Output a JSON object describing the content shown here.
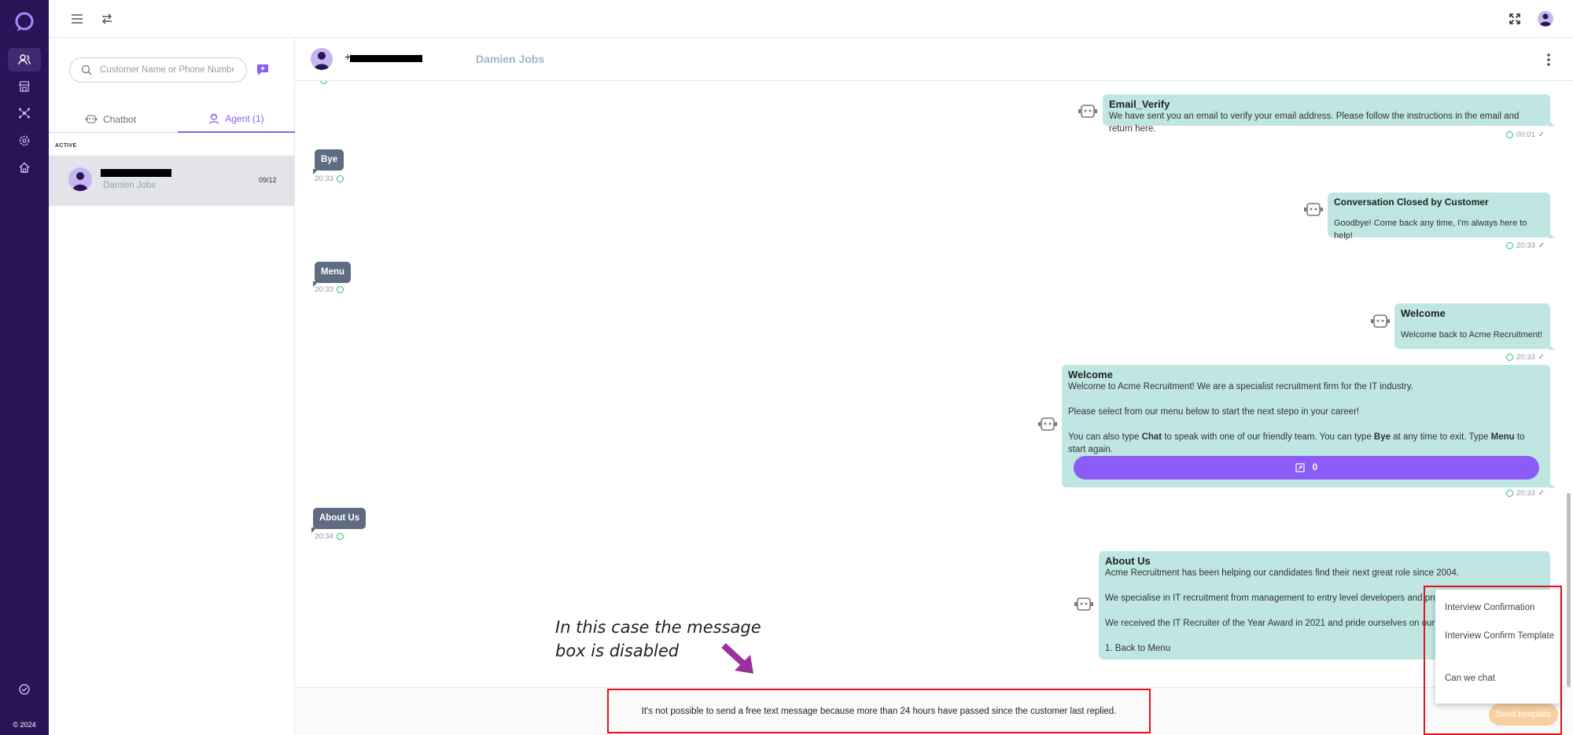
{
  "rail": {
    "copyright": "© 2024",
    "items": [
      {
        "icon": "users-icon"
      },
      {
        "icon": "store-icon"
      },
      {
        "icon": "network-icon"
      },
      {
        "icon": "gear-icon"
      },
      {
        "icon": "home-icon"
      }
    ],
    "bottom_icon": "check-circle-icon"
  },
  "sidebar": {
    "search_placeholder": "Customer Name or Phone Number",
    "tabs": {
      "chatbot": "Chatbot",
      "agent": "Agent (1)"
    },
    "section_label": "ACTIVE",
    "conversation": {
      "subtitle": "Damien Jobs",
      "date": "09/12"
    }
  },
  "chat": {
    "header": {
      "plus": "+",
      "name": "Damien Jobs"
    },
    "messages": {
      "email_verify": {
        "title": "Email_Verify",
        "text": "We have sent you an email to verify your email address. Please follow the instructions in the email and return here.",
        "time": "00:01"
      },
      "bye": {
        "text": "Bye",
        "time": "20:33"
      },
      "closed": {
        "title": "Conversation Closed by Customer",
        "text": "Goodbye! Come back any time, I'm always here to help!",
        "time": "20:33"
      },
      "menu": {
        "text": "Menu",
        "time": "20:33"
      },
      "welcome_back": {
        "title": "Welcome",
        "text": "Welcome back to Acme Recruitment!",
        "time": "20:33"
      },
      "welcome": {
        "title": "Welcome",
        "line1": "Welcome to Acme Recruitment! We are a specialist recruitment firm for the IT industry.",
        "line2": "Please select from our menu below to start the next stepo in your career!",
        "line3_a": "You can also type ",
        "line3_b": "Chat",
        "line3_c": " to speak with one of our friendly team. You can type ",
        "line3_d": "Bye",
        "line3_e": " at any time to exit. Type ",
        "line3_f": "Menu",
        "line3_g": " to start again.",
        "button_label": "0",
        "time": "20:33"
      },
      "about_in": {
        "text": "About Us",
        "time": "20:34"
      },
      "about_out": {
        "title": "About Us",
        "line1": "Acme Recruitment has been helping our candidates find their next great role since 2004.",
        "line2": "We specialise in IT recruitment from management to entry level developers and progra",
        "line3": "We received the IT Recruiter of the Year Award in 2021 and pride ourselves on our prof",
        "line4": "1.   Back to Menu"
      }
    }
  },
  "annotation": {
    "line1": "In this case the message",
    "line2": "box is disabled"
  },
  "footer": {
    "disabled_message": "It's not possible to send a free text message because more than 24 hours have passed since the customer last replied.",
    "send_template": "Send template"
  },
  "template_menu": [
    "Interview Confirmation",
    "Interview Confirm Template",
    "Can we chat"
  ],
  "colors": {
    "rail": "#2a1457",
    "accent": "#8b5cf6",
    "bubble_out": "#bfe6e2",
    "bubble_in": "#5f6b80",
    "alert": "#e0141e"
  }
}
